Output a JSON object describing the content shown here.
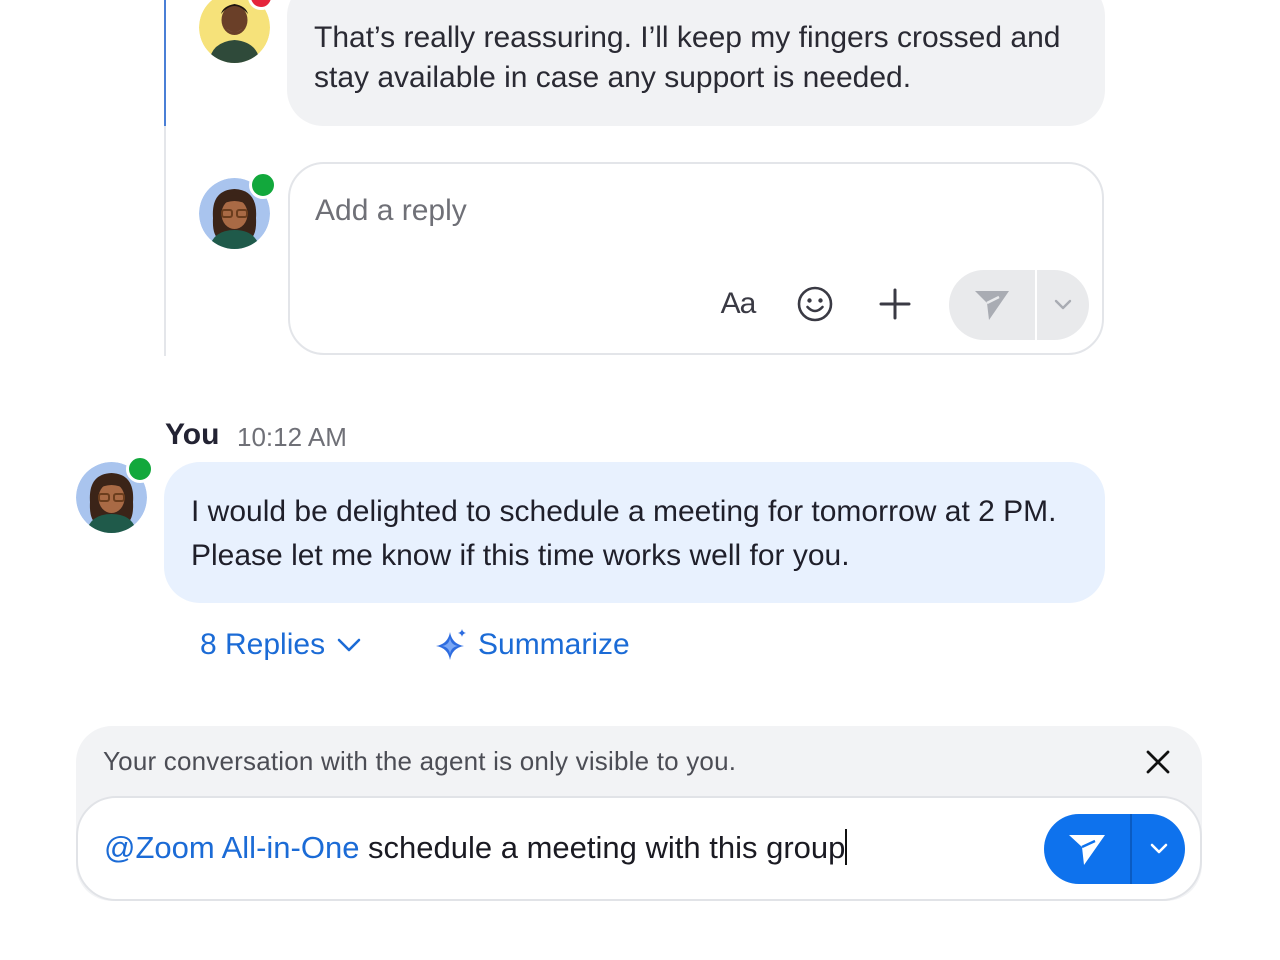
{
  "thread": {
    "previous_reply": {
      "text": "That’s really reassuring. I’ll keep my fingers crossed and stay available in case any support is needed."
    },
    "reply_composer": {
      "placeholder": "Add a reply",
      "format_label": "Aa",
      "icons": [
        "format-text-icon",
        "emoji-icon",
        "plus-icon",
        "send-icon",
        "chevron-down-icon"
      ]
    }
  },
  "message": {
    "sender": "You",
    "time": "10:12 AM",
    "text": "I would be delighted to schedule a meeting for tomorrow at 2 PM. Please let me know if this time works well for you.",
    "replies_label": "8 Replies",
    "summarize_label": "Summarize"
  },
  "agent": {
    "notice": "Your conversation with the agent is only visible to you.",
    "mention": "@Zoom All-in-One",
    "typed_text": " schedule a meeting with this group"
  },
  "colors": {
    "accent": "#0e72ed",
    "link": "#1b6bd6",
    "presence_online": "#12a83c",
    "presence_busy": "#e5243b",
    "own_bubble": "#e8f1fe",
    "other_bubble": "#f1f2f4"
  }
}
